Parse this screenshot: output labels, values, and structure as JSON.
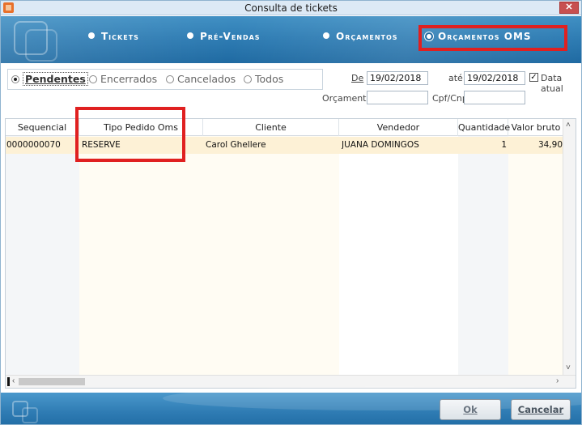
{
  "window": {
    "title": "Consulta de tickets",
    "close_label": "✕"
  },
  "nav": {
    "options": [
      {
        "label": "Tickets",
        "selected": false
      },
      {
        "label": "Pré-Vendas",
        "selected": false
      },
      {
        "label": "Orçamentos",
        "selected": false
      },
      {
        "label": "Orçamentos OMS",
        "selected": true
      }
    ]
  },
  "status_filter": {
    "options": [
      {
        "label": "Pendentes",
        "selected": true
      },
      {
        "label": "Encerrados",
        "selected": false
      },
      {
        "label": "Cancelados",
        "selected": false
      },
      {
        "label": "Todos",
        "selected": false
      }
    ]
  },
  "date_filter": {
    "from_label": "De",
    "from_value": "19/02/2018",
    "to_label": "até",
    "to_value": "19/02/2018",
    "current_date_label": "Data atual",
    "current_date_checked": true,
    "current_date_mark": "✓"
  },
  "search": {
    "orcamento_label": "Orçamento",
    "orcamento_value": "",
    "cpf_label": "Cpf/Cnpj",
    "cpf_value": ""
  },
  "grid": {
    "columns": [
      "Sequencial",
      "Tipo Pedido Oms",
      "Cliente",
      "Vendedor",
      "Quantidade",
      "Valor bruto"
    ],
    "rows": [
      {
        "sequencial": "0000000070",
        "tipo_pedido_oms": "RESERVE",
        "cliente": "Carol Ghellere",
        "vendedor": "JUANA DOMINGOS",
        "quantidade": "1",
        "valor_bruto": "34,90"
      }
    ]
  },
  "footer": {
    "ok_label": "Ok",
    "cancel_label": "Cancelar"
  },
  "colors": {
    "header_blue": "#2f7db4",
    "highlight_red": "#e02020",
    "selected_row": "#fdf1d6"
  }
}
